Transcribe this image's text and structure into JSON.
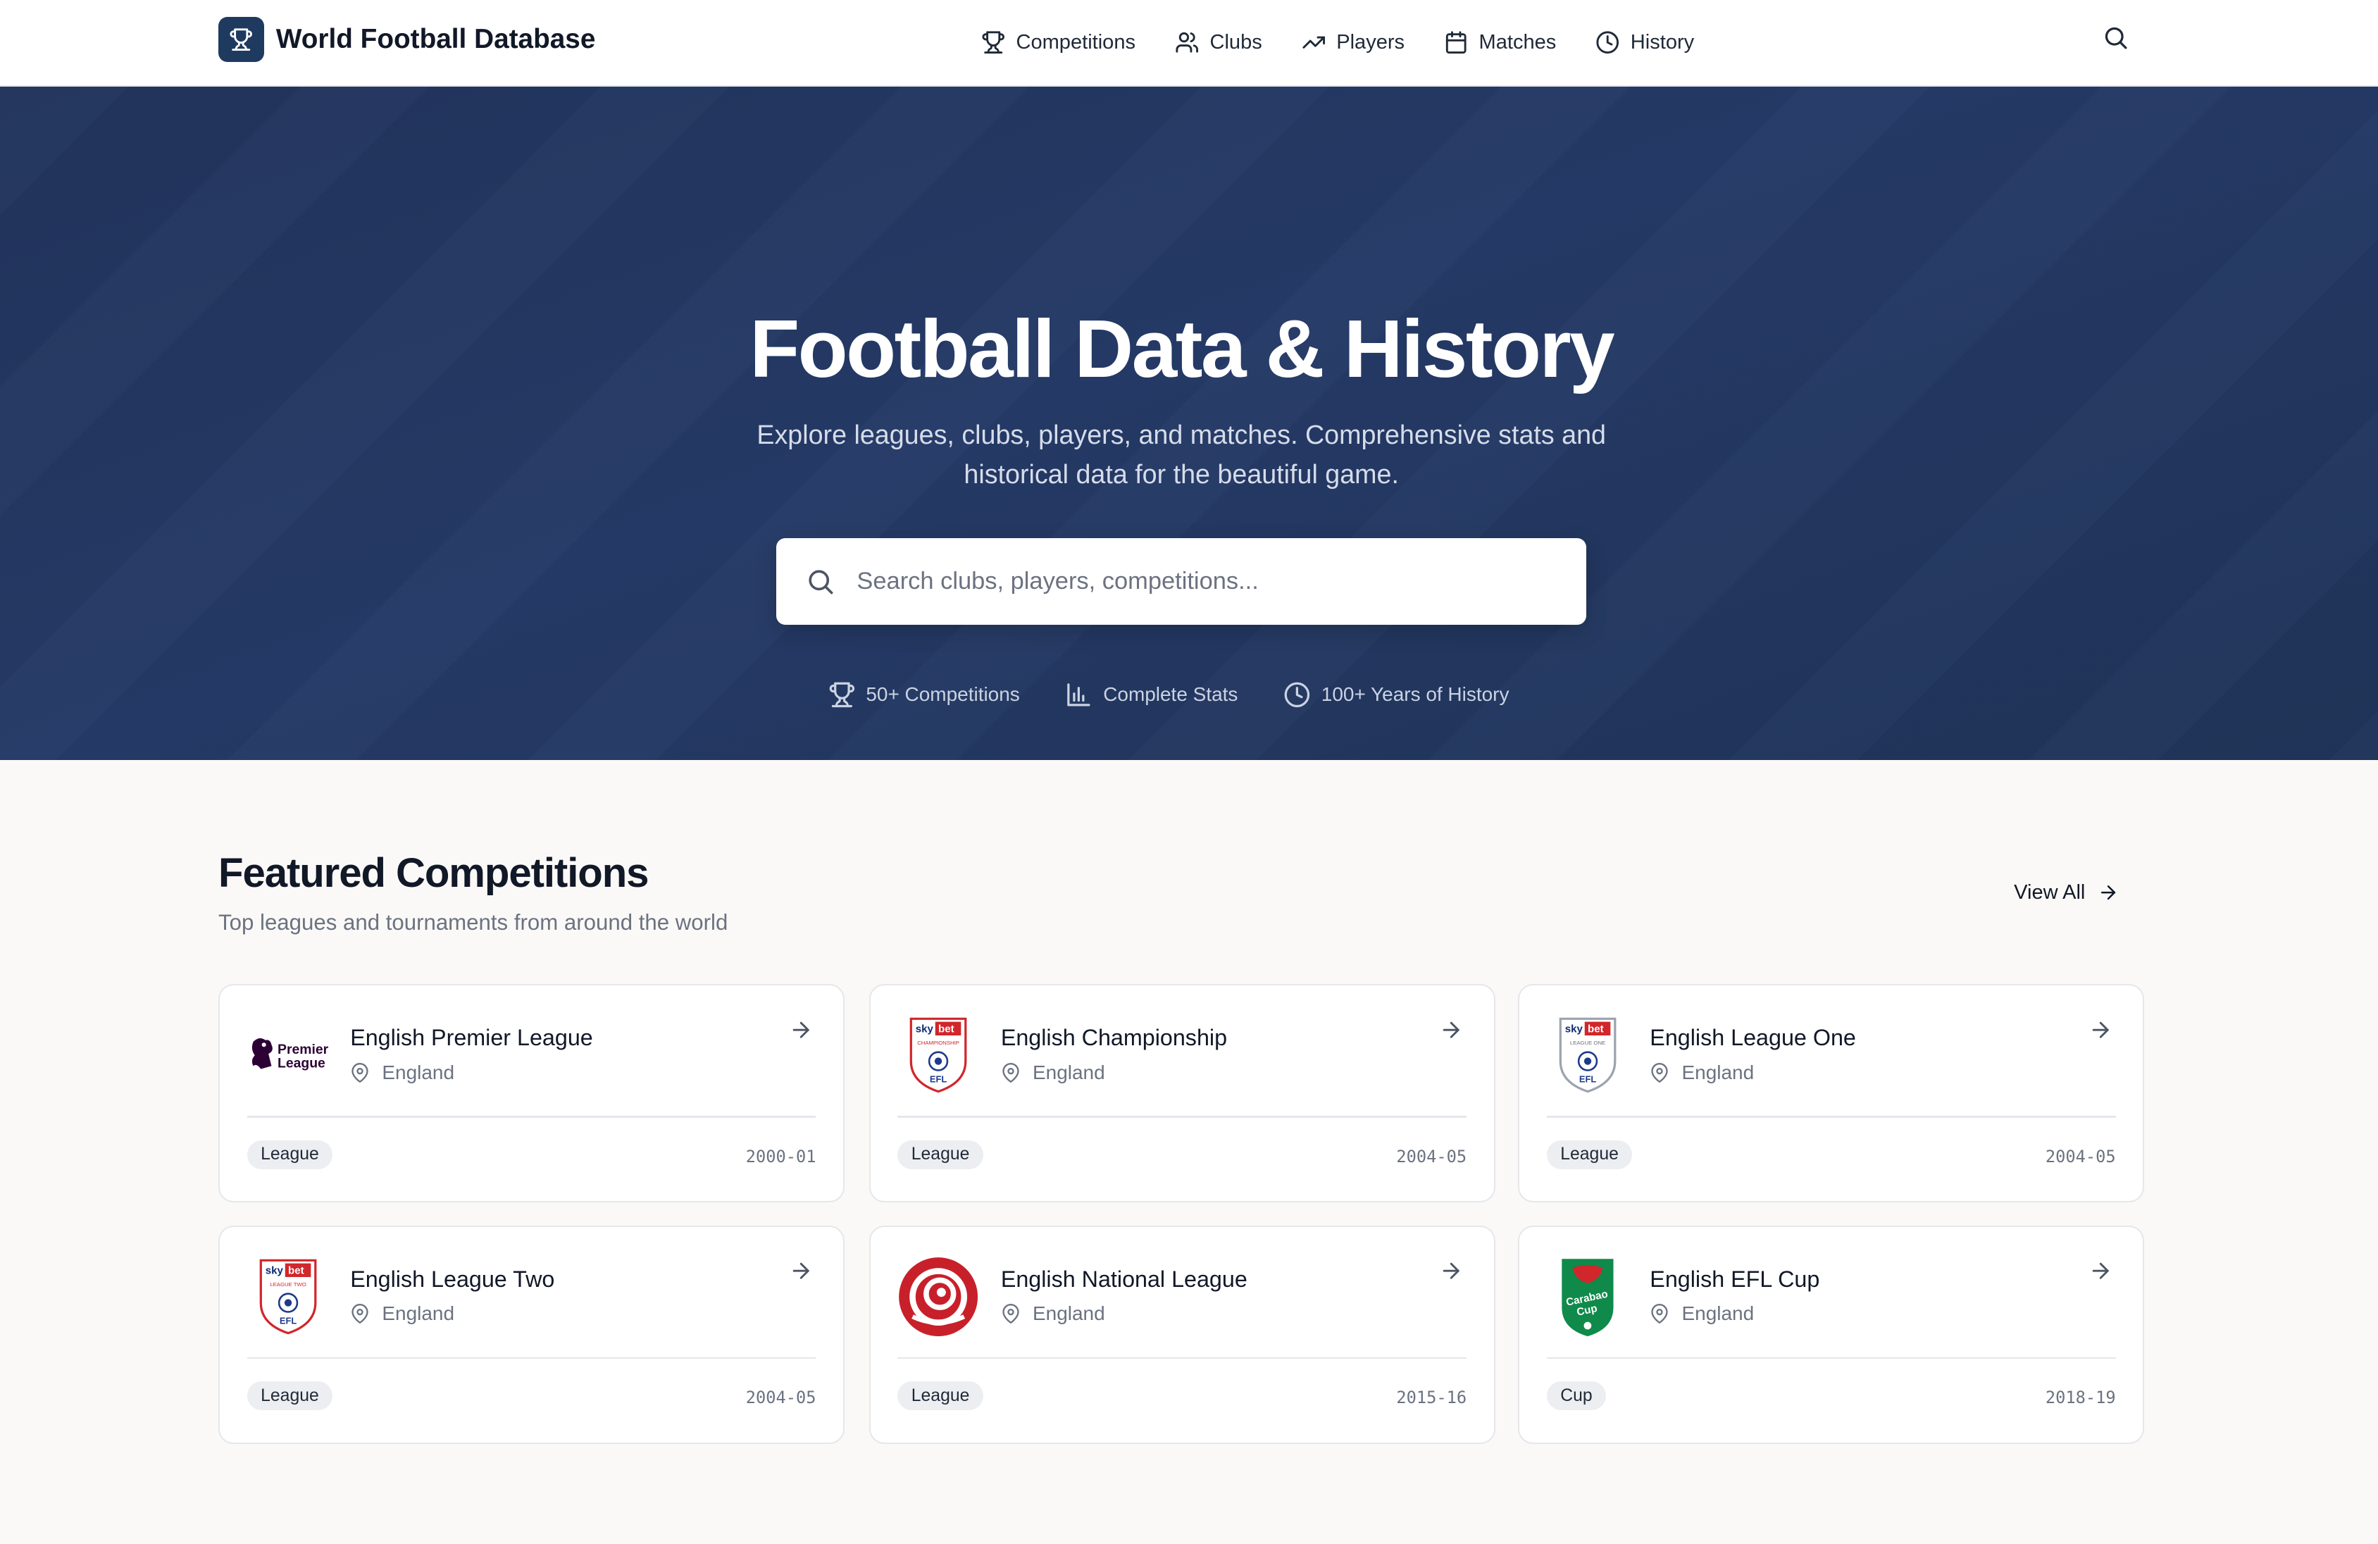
{
  "header": {
    "brand_title": "World Football Database",
    "nav": [
      {
        "label": "Competitions",
        "icon": "trophy-icon"
      },
      {
        "label": "Clubs",
        "icon": "users-icon"
      },
      {
        "label": "Players",
        "icon": "trending-up-icon"
      },
      {
        "label": "Matches",
        "icon": "calendar-icon"
      },
      {
        "label": "History",
        "icon": "clock-icon"
      }
    ]
  },
  "hero": {
    "title": "Football Data & History",
    "subtitle": "Explore leagues, clubs, players, and matches. Comprehensive stats and historical data for the beautiful game.",
    "search_placeholder": "Search clubs, players, competitions...",
    "features": [
      {
        "label": "50+ Competitions",
        "icon": "trophy-icon"
      },
      {
        "label": "Complete Stats",
        "icon": "bar-chart-icon"
      },
      {
        "label": "100+ Years of History",
        "icon": "clock-icon"
      }
    ]
  },
  "featured": {
    "title": "Featured Competitions",
    "subtitle": "Top leagues and tournaments from around the world",
    "view_all": "View All",
    "cards": [
      {
        "name": "English Premier League",
        "country": "England",
        "type": "League",
        "season": "2000-01",
        "logo": "premier-league-logo",
        "logo_text": "Premier League"
      },
      {
        "name": "English Championship",
        "country": "England",
        "type": "League",
        "season": "2004-05",
        "logo": "efl-championship-logo",
        "logo_text": "CHAMPIONSHIP"
      },
      {
        "name": "English League One",
        "country": "England",
        "type": "League",
        "season": "2004-05",
        "logo": "efl-league-one-logo",
        "logo_text": "LEAGUE ONE"
      },
      {
        "name": "English League Two",
        "country": "England",
        "type": "League",
        "season": "2004-05",
        "logo": "efl-league-two-logo",
        "logo_text": "LEAGUE TWO"
      },
      {
        "name": "English National League",
        "country": "England",
        "type": "League",
        "season": "2015-16",
        "logo": "national-league-logo",
        "logo_text": ""
      },
      {
        "name": "English EFL Cup",
        "country": "England",
        "type": "Cup",
        "season": "2018-19",
        "logo": "carabao-cup-logo",
        "logo_text": "Carabao Cup"
      }
    ]
  },
  "colors": {
    "brand": "#1e3a5f",
    "hero_bg": "#243862",
    "page_bg": "#faf9f7",
    "sky_bet_red": "#d1262b",
    "national_league_red": "#c8202a",
    "carabao_green": "#0f8a4a"
  }
}
